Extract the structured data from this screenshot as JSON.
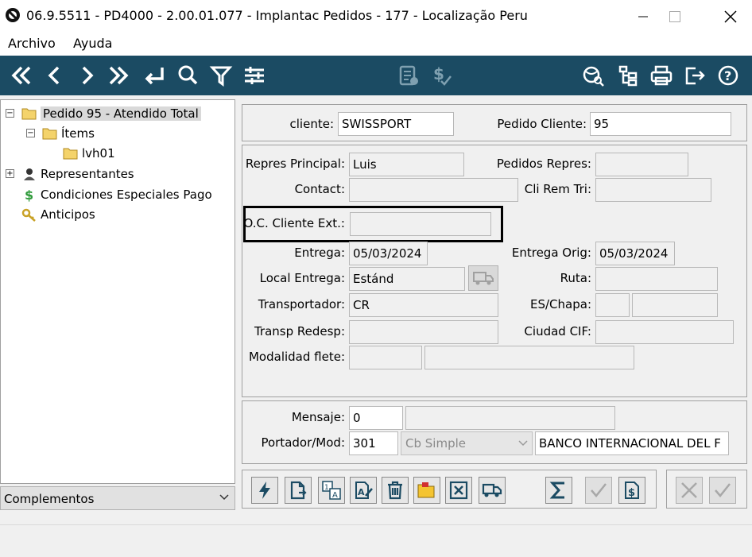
{
  "window": {
    "title": "06.9.5511 - PD4000 - 2.00.01.077 - Implantac Pedidos - 177 - Localização Peru"
  },
  "menu": {
    "items": [
      "Archivo",
      "Ayuda"
    ]
  },
  "tree": {
    "root": "Pedido 95 - Atendido Total",
    "items_node": "Ítems",
    "item_child": "lvh01",
    "representantes": "Representantes",
    "condiciones": "Condiciones Especiales Pago",
    "anticipos": "Anticipos"
  },
  "complementos": {
    "selected": "Complementos"
  },
  "header": {
    "cliente_label": "cliente:",
    "cliente_value": "SWISSPORT",
    "pedido_cliente_label": "Pedido Cliente:",
    "pedido_cliente_value": "95"
  },
  "form": {
    "repres_principal_label": "Repres Principal:",
    "repres_principal_value": "Luis",
    "pedidos_repres_label": "Pedidos Repres:",
    "pedidos_repres_value": "",
    "contact_label": "Contact:",
    "contact_value": "",
    "cli_rem_tri_label": "Cli Rem Tri:",
    "cli_rem_tri_value": "",
    "oc_cliente_ext_label": "O.C. Cliente Ext.:",
    "oc_cliente_ext_value": "",
    "entrega_label": "Entrega:",
    "entrega_value": "05/03/2024",
    "entrega_orig_label": "Entrega Orig:",
    "entrega_orig_value": "05/03/2024",
    "local_entrega_label": "Local Entrega:",
    "local_entrega_value": "Estánd",
    "ruta_label": "Ruta:",
    "ruta_value": "",
    "transportador_label": "Transportador:",
    "transportador_value": "CR",
    "es_chapa_label": "ES/Chapa:",
    "transp_redesp_label": "Transp Redesp:",
    "ciudad_cif_label": "Ciudad CIF:",
    "modalidad_flete_label": "Modalidad flete:"
  },
  "payment": {
    "mensaje_label": "Mensaje:",
    "mensaje_value": "0",
    "portador_label": "Portador/Mod:",
    "portador_value": "301",
    "modalidad_selected": "Cb Simple",
    "banco_value": "BANCO INTERNACIONAL DEL F"
  },
  "colors": {
    "toolbar_bg": "#1b4b63",
    "toolbar_icon": "#ffffff"
  }
}
